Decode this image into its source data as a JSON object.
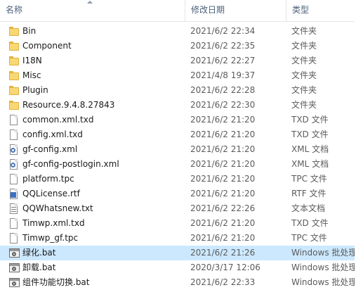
{
  "header": {
    "name": "名称",
    "date": "修改日期",
    "type": "类型"
  },
  "rows": [
    {
      "name": "Bin",
      "date": "2021/6/2 22:34",
      "type": "文件夹",
      "icon": "folder-icon"
    },
    {
      "name": "Component",
      "date": "2021/6/2 22:35",
      "type": "文件夹",
      "icon": "folder-icon"
    },
    {
      "name": "I18N",
      "date": "2021/6/2 22:27",
      "type": "文件夹",
      "icon": "folder-icon"
    },
    {
      "name": "Misc",
      "date": "2021/4/8 19:37",
      "type": "文件夹",
      "icon": "folder-icon"
    },
    {
      "name": "Plugin",
      "date": "2021/6/2 22:28",
      "type": "文件夹",
      "icon": "folder-icon"
    },
    {
      "name": "Resource.9.4.8.27843",
      "date": "2021/6/2 22:30",
      "type": "文件夹",
      "icon": "folder-icon"
    },
    {
      "name": "common.xml.txd",
      "date": "2021/6/2 21:20",
      "type": "TXD 文件",
      "icon": "file-icon"
    },
    {
      "name": "config.xml.txd",
      "date": "2021/6/2 21:20",
      "type": "TXD 文件",
      "icon": "file-icon"
    },
    {
      "name": "gf-config.xml",
      "date": "2021/6/2 21:20",
      "type": "XML 文档",
      "icon": "xml-file-icon"
    },
    {
      "name": "gf-config-postlogin.xml",
      "date": "2021/6/2 21:20",
      "type": "XML 文档",
      "icon": "xml-file-icon"
    },
    {
      "name": "platform.tpc",
      "date": "2021/6/2 21:20",
      "type": "TPC 文件",
      "icon": "file-icon"
    },
    {
      "name": "QQLicense.rtf",
      "date": "2021/6/2 21:20",
      "type": "RTF 文件",
      "icon": "rtf-file-icon"
    },
    {
      "name": "QQWhatsnew.txt",
      "date": "2021/6/2 22:26",
      "type": "文本文档",
      "icon": "text-file-icon"
    },
    {
      "name": "Timwp.xml.txd",
      "date": "2021/6/2 21:20",
      "type": "TXD 文件",
      "icon": "file-icon"
    },
    {
      "name": "Timwp_gf.tpc",
      "date": "2021/6/2 21:20",
      "type": "TPC 文件",
      "icon": "file-icon"
    },
    {
      "name": "绿化.bat",
      "date": "2021/6/2 21:26",
      "type": "Windows 批处理",
      "icon": "batch-file-icon",
      "selected": true
    },
    {
      "name": "卸载.bat",
      "date": "2020/3/17 12:06",
      "type": "Windows 批处理",
      "icon": "batch-file-icon"
    },
    {
      "name": "组件功能切换.bat",
      "date": "2021/6/2 22:33",
      "type": "Windows 批处理",
      "icon": "batch-file-icon"
    }
  ],
  "colors": {
    "selected_row": "#cce8ff",
    "header_text": "#4c607a",
    "folder": "#f8d775"
  }
}
